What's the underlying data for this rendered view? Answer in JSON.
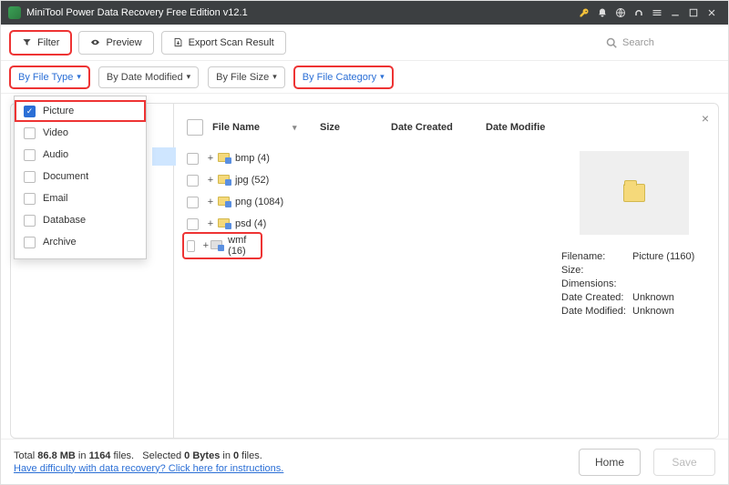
{
  "title": "MiniTool Power Data Recovery Free Edition v12.1",
  "toolbar": {
    "filter": "Filter",
    "preview": "Preview",
    "export": "Export Scan Result",
    "search_placeholder": "Search"
  },
  "filterbar": {
    "by_file_type": "By File Type",
    "by_date_modified": "By Date Modified",
    "by_file_size": "By File Size",
    "by_file_category": "By File Category"
  },
  "dropdown": {
    "items": [
      {
        "label": "Picture",
        "checked": true,
        "highlight": true
      },
      {
        "label": "Video",
        "checked": false
      },
      {
        "label": "Audio",
        "checked": false
      },
      {
        "label": "Document",
        "checked": false
      },
      {
        "label": "Email",
        "checked": false
      },
      {
        "label": "Database",
        "checked": false
      },
      {
        "label": "Archive",
        "checked": false
      }
    ]
  },
  "columns": {
    "file_name": "File Name",
    "size": "Size",
    "date_created": "Date Created",
    "date_modified": "Date Modifie"
  },
  "rows": [
    {
      "name": "bmp (4)"
    },
    {
      "name": "jpg (52)"
    },
    {
      "name": "png (1084)"
    },
    {
      "name": "psd (4)"
    },
    {
      "name": "wmf (16)",
      "highlight": true,
      "icon": "gray"
    }
  ],
  "preview": {
    "filename_k": "Filename:",
    "filename_v": "Picture (1160)",
    "size_k": "Size:",
    "size_v": "",
    "dims_k": "Dimensions:",
    "dims_v": "",
    "dc_k": "Date Created:",
    "dc_v": "Unknown",
    "dm_k": "Date Modified:",
    "dm_v": "Unknown"
  },
  "status": {
    "total_a": "Total ",
    "total_b": "86.8 MB",
    "total_c": " in ",
    "total_d": "1164",
    "total_e": " files.",
    "sel_a": "Selected ",
    "sel_b": "0 Bytes",
    "sel_c": " in ",
    "sel_d": "0",
    "sel_e": " files.",
    "help": "Have difficulty with data recovery? Click here for instructions.",
    "home": "Home",
    "save": "Save"
  }
}
